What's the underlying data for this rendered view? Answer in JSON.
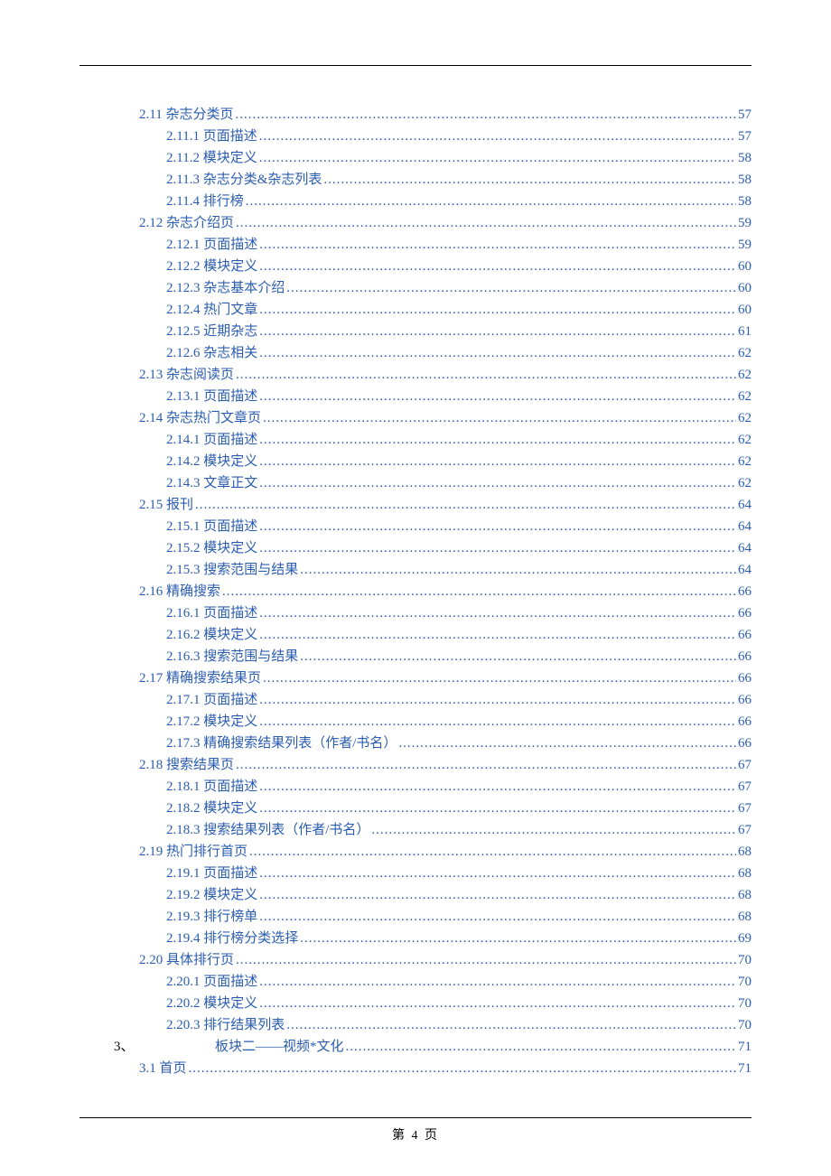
{
  "page_footer": "第 4 页",
  "chapter": {
    "number": "3、",
    "title": "板块二——视频*文化",
    "page": "71"
  },
  "toc": [
    {
      "level": 2,
      "label": "2.11 杂志分类页",
      "page": "57"
    },
    {
      "level": 3,
      "label": "2.11.1 页面描述",
      "page": "57"
    },
    {
      "level": 3,
      "label": "2.11.2 模块定义",
      "page": "58"
    },
    {
      "level": 3,
      "label": "2.11.3 杂志分类&杂志列表",
      "page": "58"
    },
    {
      "level": 3,
      "label": "2.11.4 排行榜",
      "page": "58"
    },
    {
      "level": 2,
      "label": "2.12 杂志介绍页",
      "page": "59"
    },
    {
      "level": 3,
      "label": "2.12.1 页面描述",
      "page": "59"
    },
    {
      "level": 3,
      "label": "2.12.2 模块定义",
      "page": "60"
    },
    {
      "level": 3,
      "label": "2.12.3 杂志基本介绍",
      "page": "60"
    },
    {
      "level": 3,
      "label": "2.12.4 热门文章",
      "page": "60"
    },
    {
      "level": 3,
      "label": "2.12.5 近期杂志",
      "page": "61"
    },
    {
      "level": 3,
      "label": "2.12.6 杂志相关",
      "page": "62"
    },
    {
      "level": 2,
      "label": "2.13 杂志阅读页",
      "page": "62"
    },
    {
      "level": 3,
      "label": "2.13.1 页面描述",
      "page": "62"
    },
    {
      "level": 2,
      "label": "2.14 杂志热门文章页",
      "page": "62"
    },
    {
      "level": 3,
      "label": "2.14.1 页面描述",
      "page": "62"
    },
    {
      "level": 3,
      "label": "2.14.2 模块定义",
      "page": "62"
    },
    {
      "level": 3,
      "label": "2.14.3 文章正文",
      "page": "62"
    },
    {
      "level": 2,
      "label": "2.15 报刊",
      "page": "64"
    },
    {
      "level": 3,
      "label": "2.15.1 页面描述",
      "page": "64"
    },
    {
      "level": 3,
      "label": "2.15.2 模块定义",
      "page": "64"
    },
    {
      "level": 3,
      "label": "2.15.3 搜索范围与结果",
      "page": "64"
    },
    {
      "level": 2,
      "label": "2.16 精确搜索",
      "page": "66"
    },
    {
      "level": 3,
      "label": "2.16.1 页面描述",
      "page": "66"
    },
    {
      "level": 3,
      "label": "2.16.2 模块定义",
      "page": "66"
    },
    {
      "level": 3,
      "label": "2.16.3 搜索范围与结果",
      "page": "66"
    },
    {
      "level": 2,
      "label": "2.17 精确搜索结果页",
      "page": "66"
    },
    {
      "level": 3,
      "label": "2.17.1 页面描述",
      "page": "66"
    },
    {
      "level": 3,
      "label": "2.17.2 模块定义",
      "page": "66"
    },
    {
      "level": 3,
      "label": "2.17.3 精确搜索结果列表（作者/书名）",
      "page": "66"
    },
    {
      "level": 2,
      "label": "2.18 搜索结果页",
      "page": "67"
    },
    {
      "level": 3,
      "label": "2.18.1 页面描述",
      "page": "67"
    },
    {
      "level": 3,
      "label": "2.18.2 模块定义",
      "page": "67"
    },
    {
      "level": 3,
      "label": "2.18.3 搜索结果列表（作者/书名）",
      "page": "67"
    },
    {
      "level": 2,
      "label": "2.19 热门排行首页",
      "page": "68"
    },
    {
      "level": 3,
      "label": "2.19.1 页面描述",
      "page": "68"
    },
    {
      "level": 3,
      "label": "2.19.2 模块定义",
      "page": "68"
    },
    {
      "level": 3,
      "label": "2.19.3 排行榜单",
      "page": "68"
    },
    {
      "level": 3,
      "label": "2.19.4 排行榜分类选择",
      "page": "69"
    },
    {
      "level": 2,
      "label": "2.20 具体排行页",
      "page": "70"
    },
    {
      "level": 3,
      "label": "2.20.1 页面描述",
      "page": "70"
    },
    {
      "level": 3,
      "label": "2.20.2 模块定义",
      "page": "70"
    },
    {
      "level": 3,
      "label": "2.20.3 排行结果列表",
      "page": "70"
    },
    {
      "level": 2,
      "label": "3.1 首页",
      "page": "71"
    }
  ]
}
